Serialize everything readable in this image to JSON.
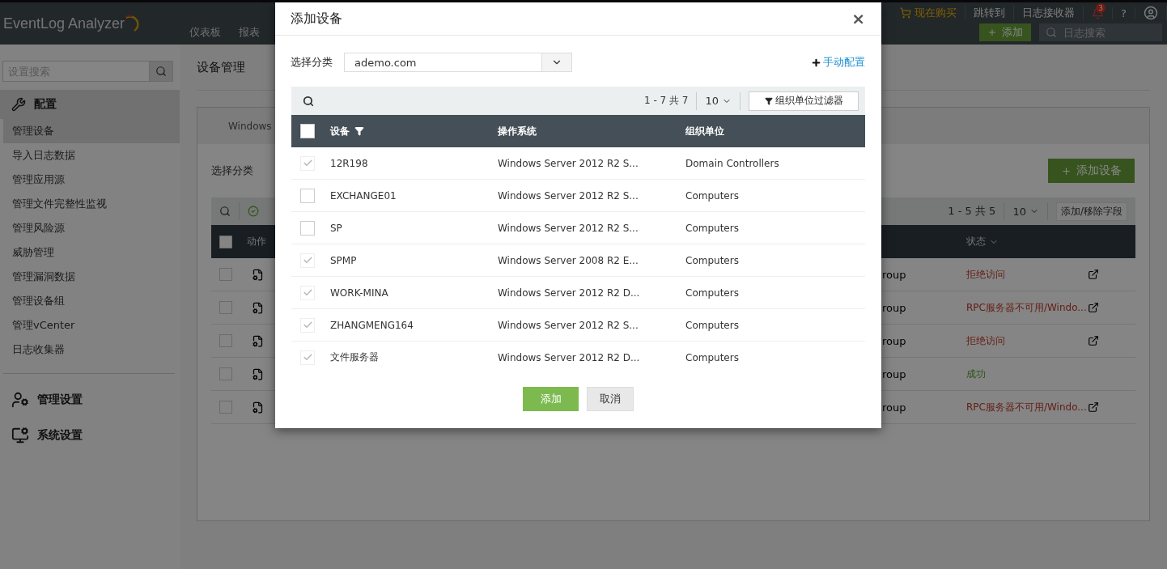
{
  "topbar": {
    "logo": "EventLog Analyzer",
    "nav": [
      {
        "label": "仪表板",
        "selected": false
      },
      {
        "label": "报表",
        "selected": false
      }
    ],
    "buy": "现在购买",
    "jump": "跳转到",
    "receiver": "日志接收器",
    "badge": "3",
    "help": "?",
    "add_button": "添加",
    "log_search": {
      "placeholder": "日志搜索"
    }
  },
  "sidebar": {
    "search": {
      "placeholder": "设置搜索"
    },
    "sections": [
      {
        "kind": "config",
        "title": "配置",
        "selected": true,
        "items": [
          {
            "label": "管理设备",
            "selected": true
          },
          {
            "label": "导入日志数据",
            "selected": false
          },
          {
            "label": "管理应用源",
            "selected": false
          },
          {
            "label": "管理文件完整性监视",
            "selected": false
          },
          {
            "label": "管理风险源",
            "selected": false
          },
          {
            "label": "威胁管理",
            "selected": false
          },
          {
            "label": "管理漏洞数据",
            "selected": false
          },
          {
            "label": "管理设备组",
            "selected": false
          },
          {
            "label": "管理vCenter",
            "selected": false
          },
          {
            "label": "日志收集器",
            "selected": false
          }
        ]
      },
      {
        "kind": "admin",
        "title": "管理设置",
        "selected": false
      },
      {
        "kind": "system",
        "title": "系统设置",
        "selected": false
      }
    ]
  },
  "main": {
    "title": "设备管理",
    "tab": "Windows",
    "category_label": "选择分类",
    "add_device": "添加设备",
    "pager": "1 - 5 共 5",
    "page_size": "10",
    "fields_button": "添加/移除字段",
    "columns": {
      "action": "动作",
      "status": "状态"
    },
    "all_checked": false,
    "rows": [
      {
        "checked": false,
        "column_3": "roup",
        "status": "拒绝访问",
        "kind": "error",
        "export": true
      },
      {
        "checked": false,
        "column_3": "roup",
        "status": "RPC服务器不可用/Windo...",
        "kind": "error",
        "export": true
      },
      {
        "checked": false,
        "column_3": "roup",
        "status": "拒绝访问",
        "kind": "error",
        "export": true
      },
      {
        "checked": false,
        "column_3": "roup",
        "status": "成功",
        "kind": "success",
        "export": false
      },
      {
        "checked": false,
        "column_3": "roup",
        "status": "RPC服务器不可用/Windo...",
        "kind": "error",
        "export": true
      }
    ]
  },
  "dialog": {
    "title": "添加设备",
    "close": "×",
    "category_label": "选择分类",
    "category_value": "ademo.com",
    "manual": "手动配置",
    "pager": "1 - 7 共 7",
    "page_size": "10",
    "ou_filter": "组织单位过滤器",
    "columns": {
      "device": "设备",
      "os": "操作系统",
      "ou": "组织单位"
    },
    "all_checked": false,
    "rows": [
      {
        "device": "12R198",
        "os": "Windows Server 2012 R2 S...",
        "ou": "Domain Controllers",
        "checked": true,
        "disabled": true
      },
      {
        "device": "EXCHANGE01",
        "os": "Windows Server 2012 R2 S...",
        "ou": "Computers",
        "checked": false,
        "disabled": false
      },
      {
        "device": "SP",
        "os": "Windows Server 2012 R2 S...",
        "ou": "Computers",
        "checked": false,
        "disabled": false
      },
      {
        "device": "SPMP",
        "os": "Windows Server 2008 R2 E...",
        "ou": "Computers",
        "checked": true,
        "disabled": true
      },
      {
        "device": "WORK-MINA",
        "os": "Windows Server 2012 R2 D...",
        "ou": "Computers",
        "checked": true,
        "disabled": true
      },
      {
        "device": "ZHANGMENG164",
        "os": "Windows Server 2012 R2 S...",
        "ou": "Computers",
        "checked": true,
        "disabled": true
      },
      {
        "device": "文件服务器",
        "os": "Windows Server 2012 R2 D...",
        "ou": "Computers",
        "checked": true,
        "disabled": true
      }
    ],
    "add": "添加",
    "cancel": "取消"
  }
}
